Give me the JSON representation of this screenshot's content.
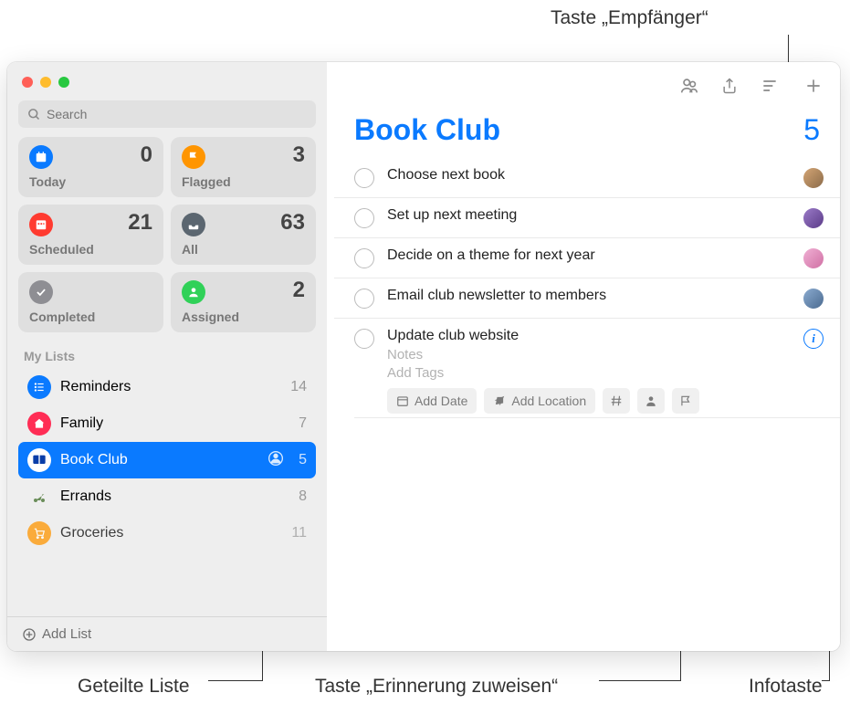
{
  "callouts": {
    "recipient": "Taste „Empfänger“",
    "shared_list": "Geteilte Liste",
    "assign_reminder": "Taste „Erinnerung zuweisen“",
    "info_button": "Infotaste"
  },
  "sidebar": {
    "search_placeholder": "Search",
    "smart": [
      {
        "label": "Today",
        "count": "0",
        "color": "#0a7aff",
        "icon": "calendar"
      },
      {
        "label": "Flagged",
        "count": "3",
        "color": "#ff9500",
        "icon": "flag"
      },
      {
        "label": "Scheduled",
        "count": "21",
        "color": "#ff3b30",
        "icon": "calendar-grid"
      },
      {
        "label": "All",
        "count": "63",
        "color": "#5b6670",
        "icon": "tray"
      },
      {
        "label": "Completed",
        "count": "",
        "color": "#8e8e93",
        "icon": "check"
      },
      {
        "label": "Assigned",
        "count": "2",
        "color": "#30d158",
        "icon": "person"
      }
    ],
    "section_label": "My Lists",
    "lists": [
      {
        "name": "Reminders",
        "count": "14",
        "color": "#0a7aff",
        "icon": "list",
        "selected": false,
        "shared": false
      },
      {
        "name": "Family",
        "count": "7",
        "color": "#ff2d55",
        "icon": "home",
        "selected": false,
        "shared": false
      },
      {
        "name": "Book Club",
        "count": "5",
        "color": "#0a3ea8",
        "icon": "book",
        "selected": true,
        "shared": true
      },
      {
        "name": "Errands",
        "count": "8",
        "color": "#d6c7a3",
        "icon": "scooter",
        "selected": false,
        "shared": false
      },
      {
        "name": "Groceries",
        "count": "11",
        "color": "#ff9500",
        "icon": "cart",
        "selected": false,
        "shared": false
      }
    ],
    "add_list_label": "Add List"
  },
  "main": {
    "title": "Book Club",
    "count": "5",
    "reminders": [
      {
        "title": "Choose next book",
        "avatar": "#c79b6a"
      },
      {
        "title": "Set up next meeting",
        "avatar": "#7b5ba8"
      },
      {
        "title": "Decide on a theme for next year",
        "avatar": "#e6a0c4"
      },
      {
        "title": "Email club newsletter to members",
        "avatar": "#6b8bb0"
      }
    ],
    "selected": {
      "title": "Update club website",
      "notes_placeholder": "Notes",
      "tags_placeholder": "Add Tags",
      "add_date": "Add Date",
      "add_location": "Add Location"
    }
  }
}
